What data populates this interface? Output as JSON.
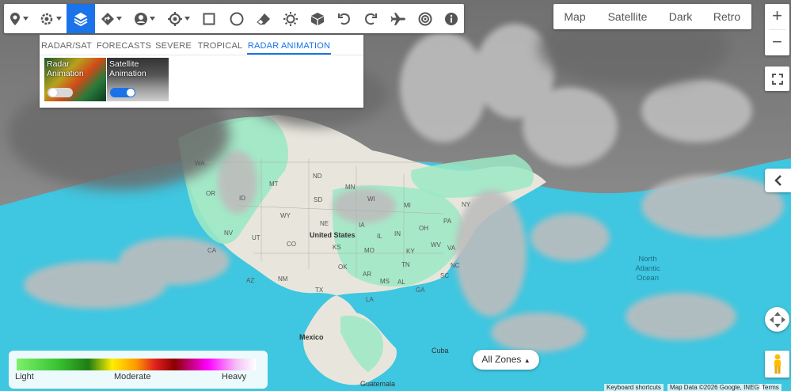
{
  "toolbar": {
    "tools": [
      {
        "icon": "location-pin-icon",
        "has_caret": true,
        "active": false
      },
      {
        "icon": "location-settings-icon",
        "has_caret": true,
        "active": false
      },
      {
        "icon": "layers-icon",
        "has_caret": false,
        "active": true
      },
      {
        "icon": "directions-icon",
        "has_caret": true,
        "active": false
      },
      {
        "icon": "user-icon",
        "has_caret": true,
        "active": false
      },
      {
        "icon": "crosshair-icon",
        "has_caret": true,
        "active": false
      },
      {
        "icon": "square-icon",
        "has_caret": false,
        "active": false
      },
      {
        "icon": "circle-icon",
        "has_caret": false,
        "active": false
      },
      {
        "icon": "eraser-icon",
        "has_caret": false,
        "active": false
      },
      {
        "icon": "sun-icon",
        "has_caret": false,
        "active": false
      },
      {
        "icon": "cube-icon",
        "has_caret": false,
        "active": false
      },
      {
        "icon": "undo-icon",
        "has_caret": false,
        "active": false
      },
      {
        "icon": "redo-icon",
        "has_caret": false,
        "active": false
      },
      {
        "icon": "airplane-icon",
        "has_caret": false,
        "active": false
      },
      {
        "icon": "radar-icon",
        "has_caret": false,
        "active": false
      },
      {
        "icon": "info-icon",
        "has_caret": false,
        "active": false
      }
    ]
  },
  "panel": {
    "tabs": [
      "RADAR/SAT",
      "FORECASTS",
      "SEVERE",
      "TROPICAL",
      "RADAR ANIMATION"
    ],
    "selected_tab": "RADAR ANIMATION",
    "cards": [
      {
        "label": "Radar Animation",
        "enabled": false
      },
      {
        "label": "Satellite Animation",
        "enabled": true
      }
    ]
  },
  "map_types": [
    "Map",
    "Satellite",
    "Dark",
    "Retro"
  ],
  "zoom": {
    "in": "+",
    "out": "−"
  },
  "map_labels": {
    "us": "United States",
    "mexico": "Mexico",
    "cuba": "Cuba",
    "guatemala": "Guatemala",
    "ocean": "North Atlantic Ocean",
    "states": [
      "WA",
      "MT",
      "WY",
      "OK",
      "TX",
      "LA",
      "MS",
      "AL",
      "KY",
      "WV",
      "VA",
      "NC",
      "SC",
      "GA",
      "NE",
      "IA",
      "IL",
      "IN",
      "OH",
      "PA",
      "NY",
      "MI",
      "WI",
      "MN",
      "ND",
      "SD",
      "KS",
      "MO",
      "AR",
      "TN",
      "ID",
      "OR",
      "NV",
      "UT",
      "CO",
      "NM",
      "AZ",
      "CA"
    ]
  },
  "legend": {
    "light": "Light",
    "moderate": "Moderate",
    "heavy": "Heavy"
  },
  "zones_button": "All Zones",
  "attribution": {
    "shortcuts": "Keyboard shortcuts",
    "data": "Map Data ©2026 Google, INEGI",
    "terms": "Terms"
  },
  "colors": {
    "accent": "#1a73e8",
    "ocean": "#3fc6e0",
    "land": "#e8e6dc",
    "radar_light": "#9be8c4"
  }
}
